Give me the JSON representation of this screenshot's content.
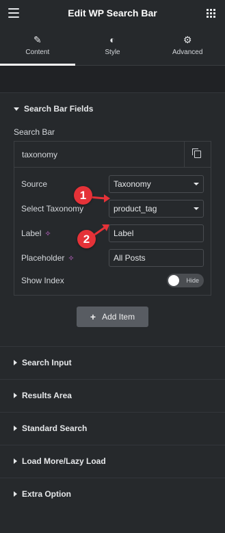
{
  "header": {
    "title": "Edit WP Search Bar"
  },
  "tabs": [
    {
      "label": "Content",
      "icon": "pencil-icon"
    },
    {
      "label": "Style",
      "icon": "contrast-icon"
    },
    {
      "label": "Advanced",
      "icon": "gear-icon"
    }
  ],
  "section_open": {
    "title": "Search Bar Fields"
  },
  "repeater": {
    "label": "Search Bar",
    "item_title": "taxonomy",
    "fields": {
      "source_label": "Source",
      "source_value": "Taxonomy",
      "taxonomy_label": "Select Taxonomy",
      "taxonomy_value": "product_tag",
      "label_label": "Label",
      "label_value": "Label",
      "placeholder_label": "Placeholder",
      "placeholder_value": "All Posts",
      "show_index_label": "Show Index",
      "show_index_toggle": "Hide"
    },
    "add_item": "Add Item"
  },
  "sections": [
    "Search Input",
    "Results Area",
    "Standard Search",
    "Load More/Lazy Load",
    "Extra Option"
  ],
  "annotations": [
    "1",
    "2"
  ],
  "colors": {
    "annotation": "#e53238",
    "ai_icon": "#d16ad9",
    "background": "#26292c"
  }
}
